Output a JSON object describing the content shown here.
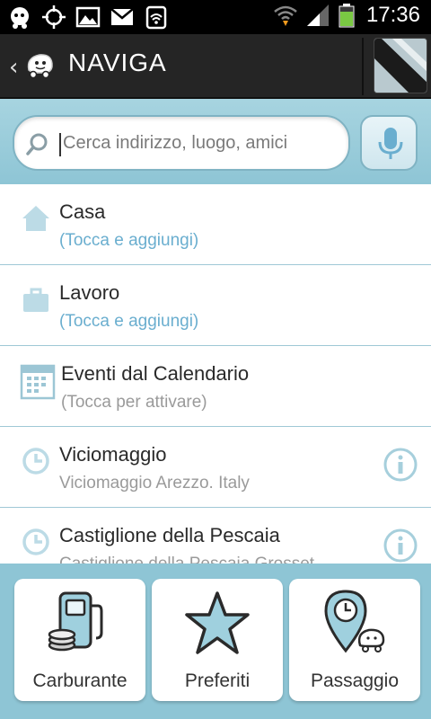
{
  "status_bar": {
    "time": "17:36"
  },
  "header": {
    "back_glyph": "‹",
    "title": "NAVIGA"
  },
  "search": {
    "placeholder": "Cerca indirizzo, luogo, amici"
  },
  "list": [
    {
      "icon": "home-icon",
      "title": "Casa",
      "subtitle": "(Tocca e aggiungi)"
    },
    {
      "icon": "briefcase-icon",
      "title": "Lavoro",
      "subtitle": "(Tocca e aggiungi)"
    },
    {
      "icon": "calendar-icon",
      "title": "Eventi dal Calendario",
      "subtitle": "(Tocca per attivare)"
    },
    {
      "icon": "clock-icon",
      "title": "Viciomaggio",
      "subtitle": "Viciomaggio Arezzo. Italy"
    },
    {
      "icon": "clock-icon",
      "title": "Castiglione della Pescaia",
      "subtitle": "Castiglione della Pescaia Grosset"
    }
  ],
  "bottom_buttons": [
    {
      "icon": "fuel-pump-icon",
      "label": "Carburante"
    },
    {
      "icon": "star-icon",
      "label": "Preferiti"
    },
    {
      "icon": "rideshare-icon",
      "label": "Passaggio"
    }
  ],
  "colors": {
    "accent": "#8ec5d5",
    "link": "#6aaecf",
    "header": "#252525"
  }
}
